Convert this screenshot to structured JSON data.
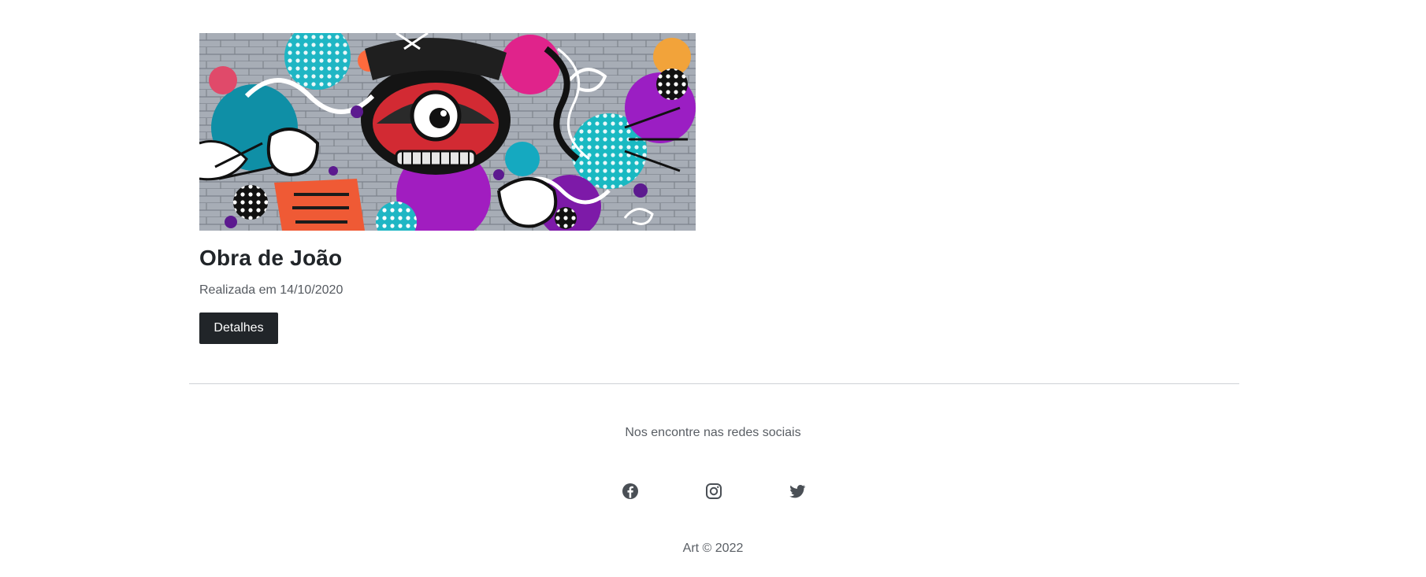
{
  "artwork": {
    "title": "Obra de João",
    "date": "Realizada em 14/10/2020",
    "button_label": "Detalhes"
  },
  "footer": {
    "social_text": "Nos encontre nas redes sociais",
    "icons": [
      "facebook-icon",
      "instagram-icon",
      "twitter-icon"
    ],
    "copyright": "Art © 2022"
  },
  "colors": {
    "button_bg": "#212529",
    "button_text": "#ffffff",
    "title": "#212529",
    "muted_text": "#595e64",
    "icon": "#4a4f55",
    "divider": "#cfd2d6"
  }
}
